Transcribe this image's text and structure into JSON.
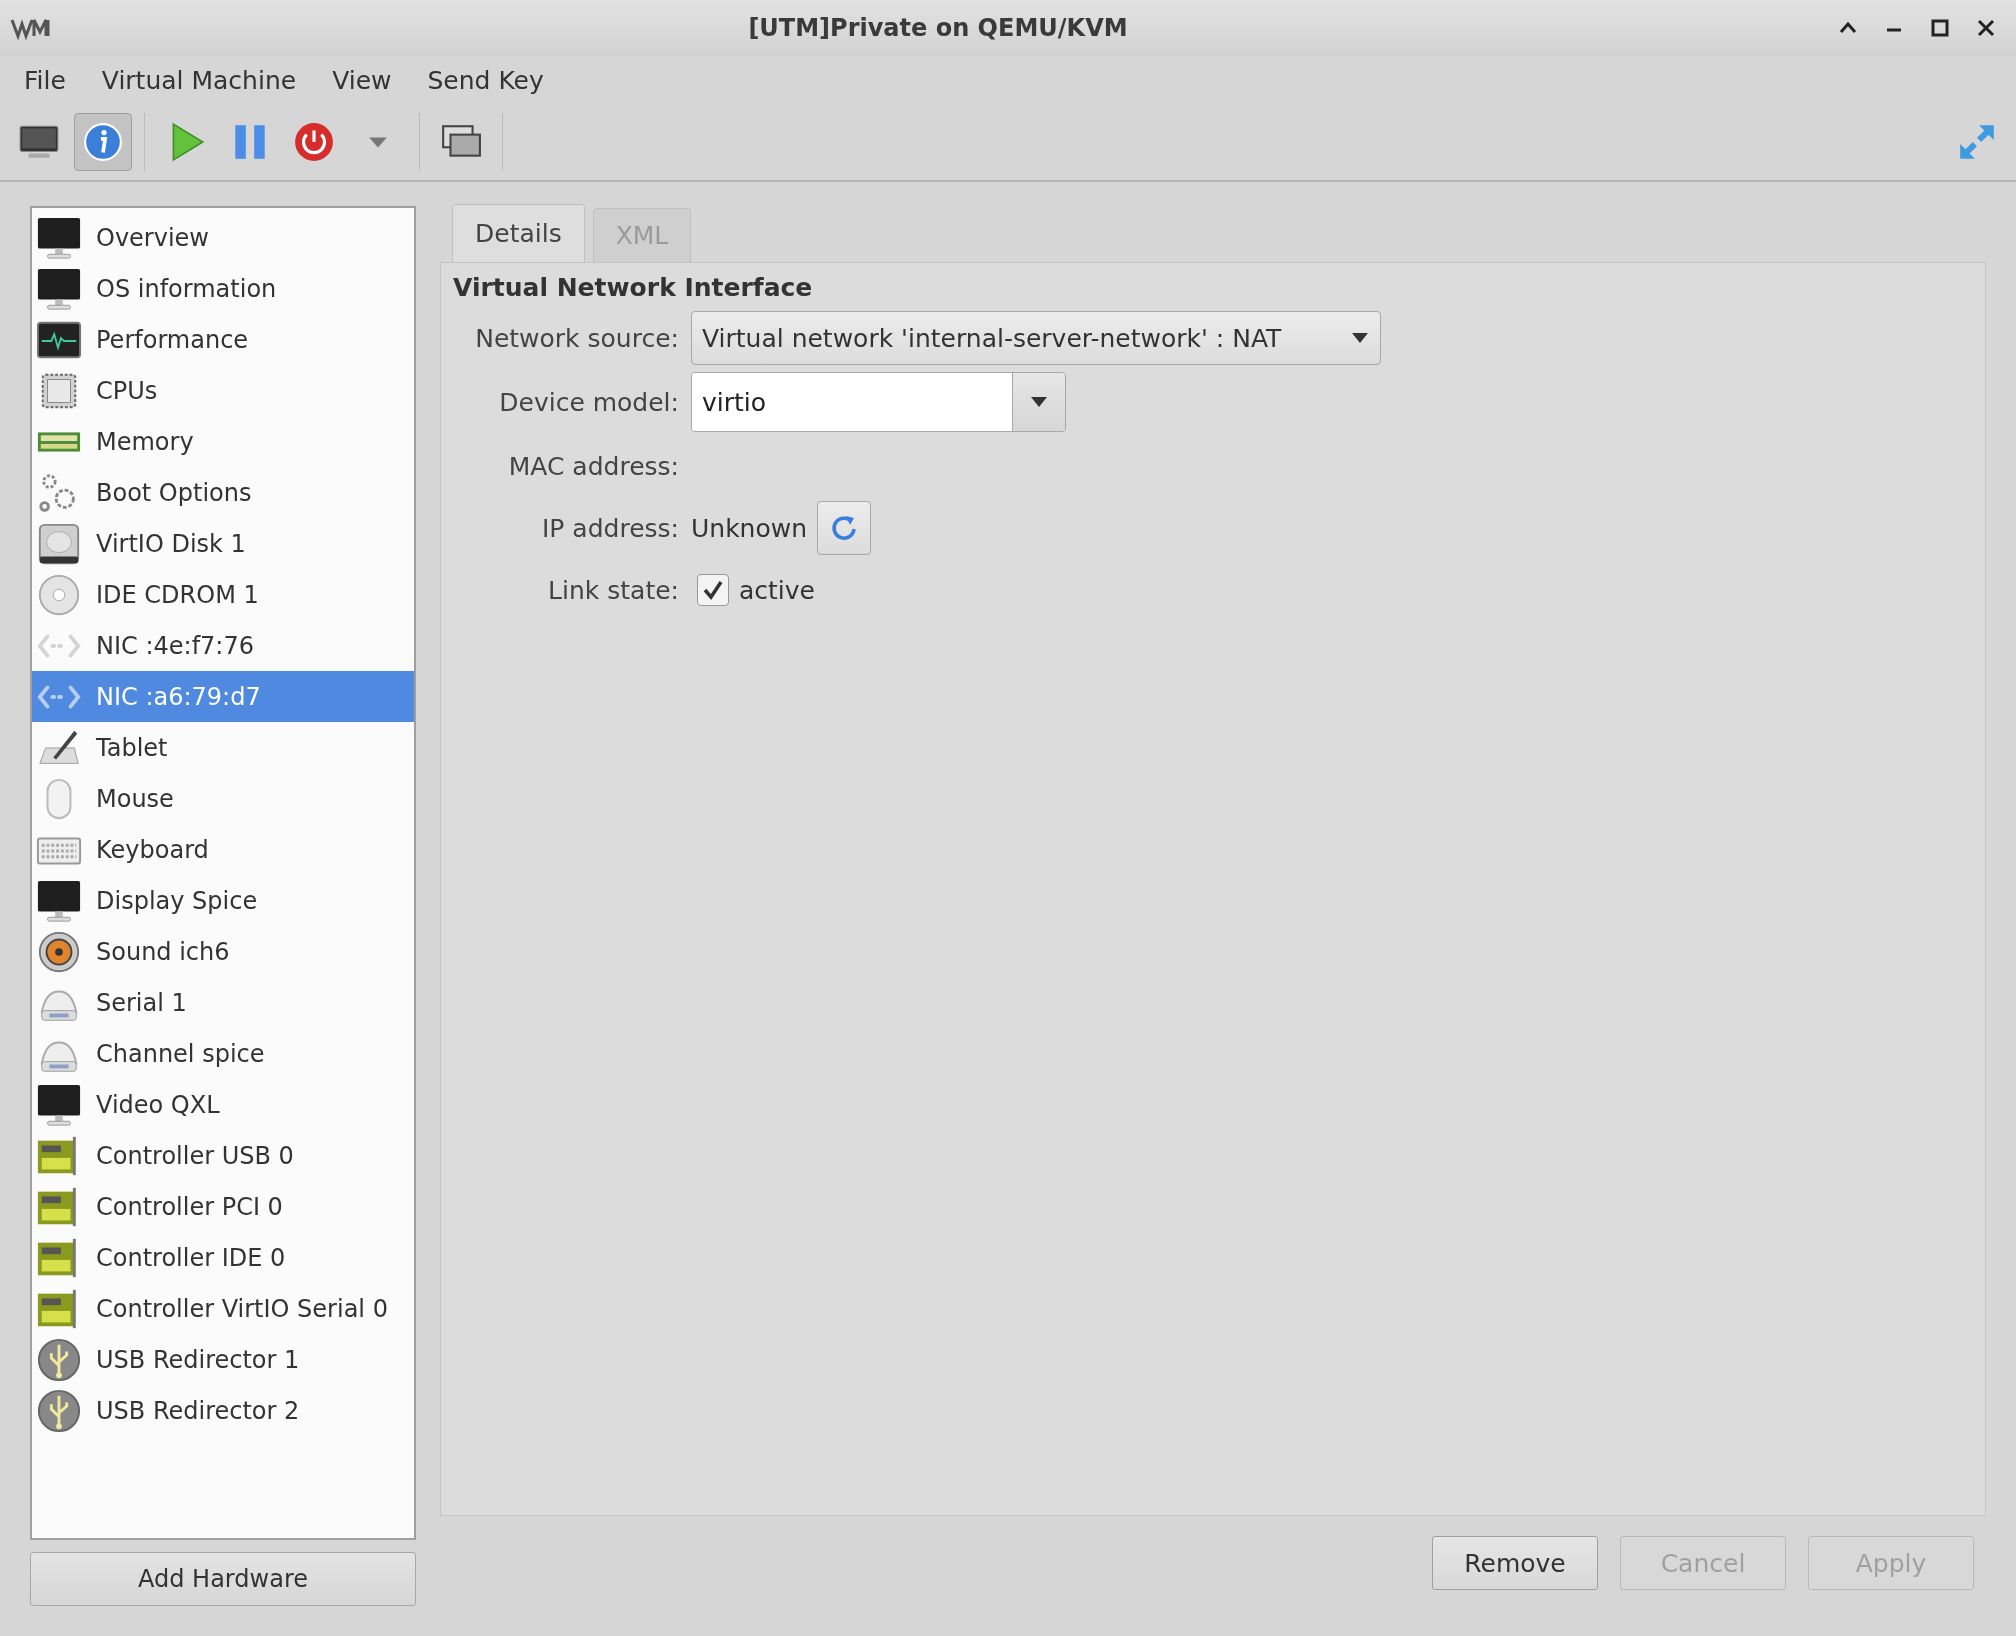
{
  "window": {
    "title": "[UTM]Private on QEMU/KVM"
  },
  "menu": [
    "File",
    "Virtual Machine",
    "View",
    "Send Key"
  ],
  "toolbar": {
    "groups": [
      [
        {
          "kind": "console",
          "pressed": false
        },
        {
          "kind": "details",
          "pressed": true
        }
      ],
      [
        {
          "kind": "run",
          "pressed": false
        },
        {
          "kind": "pause",
          "pressed": false
        },
        {
          "kind": "shutdown",
          "pressed": false
        },
        {
          "kind": "menu",
          "pressed": false
        }
      ],
      [
        {
          "kind": "screens",
          "pressed": false
        }
      ]
    ],
    "right": [
      {
        "kind": "fullscreen",
        "pressed": false
      }
    ]
  },
  "sidebar": {
    "items": [
      {
        "label": "Overview",
        "kind": "monitor",
        "selected": false
      },
      {
        "label": "OS information",
        "kind": "monitor",
        "selected": false
      },
      {
        "label": "Performance",
        "kind": "performance",
        "selected": false
      },
      {
        "label": "CPUs",
        "kind": "cpu",
        "selected": false
      },
      {
        "label": "Memory",
        "kind": "memory",
        "selected": false
      },
      {
        "label": "Boot Options",
        "kind": "gears",
        "selected": false
      },
      {
        "label": "VirtIO Disk 1",
        "kind": "disk",
        "selected": false
      },
      {
        "label": "IDE CDROM 1",
        "kind": "cdrom",
        "selected": false
      },
      {
        "label": "NIC :4e:f7:76",
        "kind": "nic",
        "selected": false
      },
      {
        "label": "NIC :a6:79:d7",
        "kind": "nic",
        "selected": true
      },
      {
        "label": "Tablet",
        "kind": "tablet",
        "selected": false
      },
      {
        "label": "Mouse",
        "kind": "mouse",
        "selected": false
      },
      {
        "label": "Keyboard",
        "kind": "keyboard",
        "selected": false
      },
      {
        "label": "Display Spice",
        "kind": "monitor",
        "selected": false
      },
      {
        "label": "Sound ich6",
        "kind": "speaker",
        "selected": false
      },
      {
        "label": "Serial 1",
        "kind": "serial",
        "selected": false
      },
      {
        "label": "Channel spice",
        "kind": "serial",
        "selected": false
      },
      {
        "label": "Video QXL",
        "kind": "monitor",
        "selected": false
      },
      {
        "label": "Controller USB 0",
        "kind": "card",
        "selected": false
      },
      {
        "label": "Controller PCI 0",
        "kind": "card",
        "selected": false
      },
      {
        "label": "Controller IDE 0",
        "kind": "card",
        "selected": false
      },
      {
        "label": "Controller VirtIO Serial 0",
        "kind": "card",
        "selected": false
      },
      {
        "label": "USB Redirector 1",
        "kind": "usb",
        "selected": false
      },
      {
        "label": "USB Redirector 2",
        "kind": "usb",
        "selected": false
      }
    ],
    "add_button": "Add Hardware"
  },
  "tabs": [
    {
      "label": "Details",
      "selected": true
    },
    {
      "label": "XML",
      "selected": false
    }
  ],
  "section": {
    "title": "Virtual Network Interface",
    "fields": [
      {
        "kind": "dropdown",
        "label": "Network source:",
        "value": "Virtual network 'internal-server-network' : NAT"
      },
      {
        "kind": "combo",
        "label": "Device model:",
        "value": "virtio"
      },
      {
        "kind": "text",
        "label": "MAC address:"
      },
      {
        "kind": "refresh",
        "label": "IP address:",
        "value": "Unknown"
      },
      {
        "kind": "checkbox",
        "label": "Link state:",
        "text": "active",
        "checked": true
      }
    ]
  },
  "buttons": [
    {
      "label": "Remove",
      "disabled": false
    },
    {
      "label": "Cancel",
      "disabled": true
    },
    {
      "label": "Apply",
      "disabled": true
    }
  ]
}
